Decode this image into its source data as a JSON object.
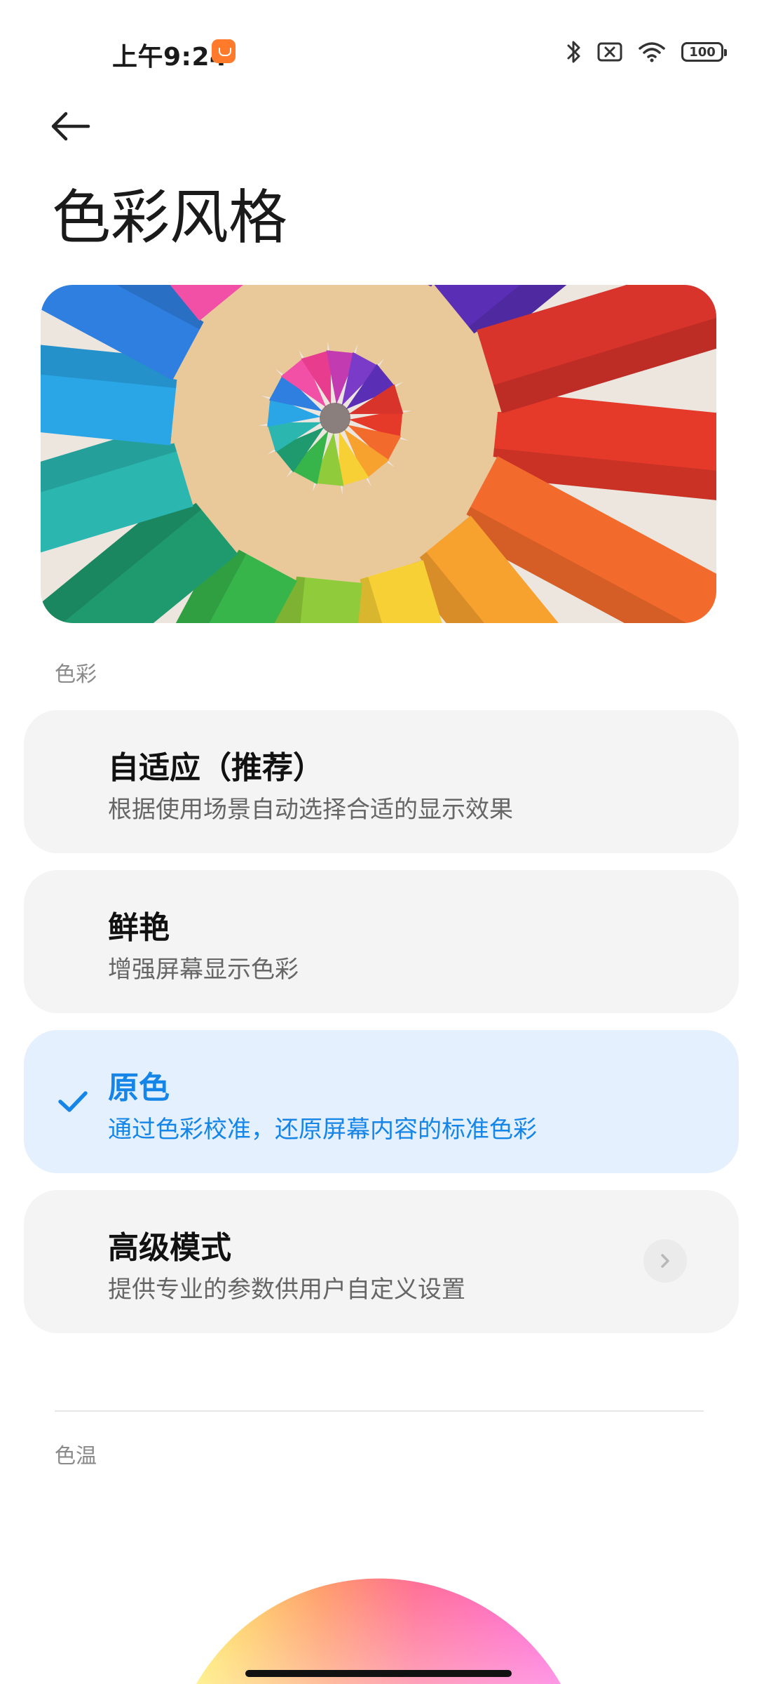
{
  "status_bar": {
    "time": "上午9:24",
    "battery": "100",
    "icons": [
      "app-notification-icon",
      "bluetooth-icon",
      "no-sim-icon",
      "wifi-icon",
      "battery-icon"
    ]
  },
  "header": {
    "back_icon": "arrow-left-icon",
    "title": "色彩风格"
  },
  "hero": {
    "icon": "colored-pencils-image"
  },
  "color_section": {
    "label": "色彩",
    "options": [
      {
        "title": "自适应（推荐）",
        "desc": "根据使用场景自动选择合适的显示效果",
        "selected": false
      },
      {
        "title": "鲜艳",
        "desc": "增强屏幕显示色彩",
        "selected": false
      },
      {
        "title": "原色",
        "desc": "通过色彩校准，还原屏幕内容的标准色彩",
        "selected": true
      },
      {
        "title": "高级模式",
        "desc": "提供专业的参数供用户自定义设置",
        "selected": false,
        "icon": "chevron-right-icon"
      }
    ]
  },
  "temperature_section": {
    "label": "色温"
  },
  "colors": {
    "accent": "#1685e8",
    "card_bg": "#f4f4f4",
    "selected_bg": "#e4f0fd"
  }
}
